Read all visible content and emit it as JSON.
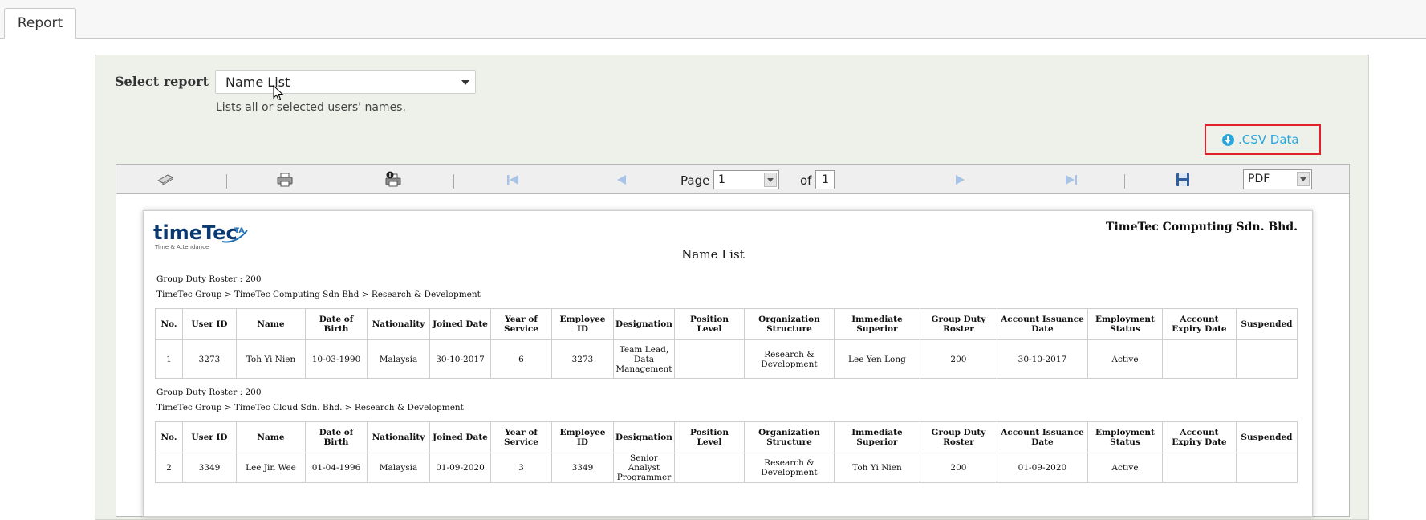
{
  "tabs": [
    {
      "label": "Report"
    }
  ],
  "report_selector": {
    "label": "Select report",
    "selected": "Name List",
    "description": "Lists all or selected users' names."
  },
  "csv_button": {
    "label": ".CSV Data"
  },
  "toolbar": {
    "page_label": "Page",
    "page_value": "1",
    "of_label": "of",
    "total_pages": "1",
    "export_format": "PDF"
  },
  "report": {
    "company": "TimeTec Computing Sdn. Bhd.",
    "title": "Name List",
    "logo_text": "timeTec",
    "logo_suffix": "TA",
    "logo_tagline": "Time & Attendance",
    "columns": [
      "No.",
      "User ID",
      "Name",
      "Date of Birth",
      "Nationality",
      "Joined Date",
      "Year of Service",
      "Employee ID",
      "Designation",
      "Position Level",
      "Organization Structure",
      "Immediate Superior",
      "Group Duty Roster",
      "Account Issuance Date",
      "Employment Status",
      "Account Expiry Date",
      "Suspended"
    ],
    "groups": [
      {
        "roster": "Group Duty Roster : 200",
        "path": "TimeTec Group > TimeTec Computing Sdn Bhd > Research & Development",
        "rows": [
          [
            "1",
            "3273",
            "Toh Yi Nien",
            "10-03-1990",
            "Malaysia",
            "30-10-2017",
            "6",
            "3273",
            "Team Lead, Data Management",
            "",
            "Research & Development",
            "Lee Yen Long",
            "200",
            "30-10-2017",
            "Active",
            "",
            ""
          ]
        ]
      },
      {
        "roster": "Group Duty Roster : 200",
        "path": "TimeTec Group > TimeTec Cloud Sdn. Bhd. > Research & Development",
        "rows": [
          [
            "2",
            "3349",
            "Lee Jin Wee",
            "01-04-1996",
            "Malaysia",
            "01-09-2020",
            "3",
            "3349",
            "Senior Analyst Programmer",
            "",
            "Research & Development",
            "Toh Yi Nien",
            "200",
            "01-09-2020",
            "Active",
            "",
            ""
          ]
        ]
      }
    ]
  }
}
